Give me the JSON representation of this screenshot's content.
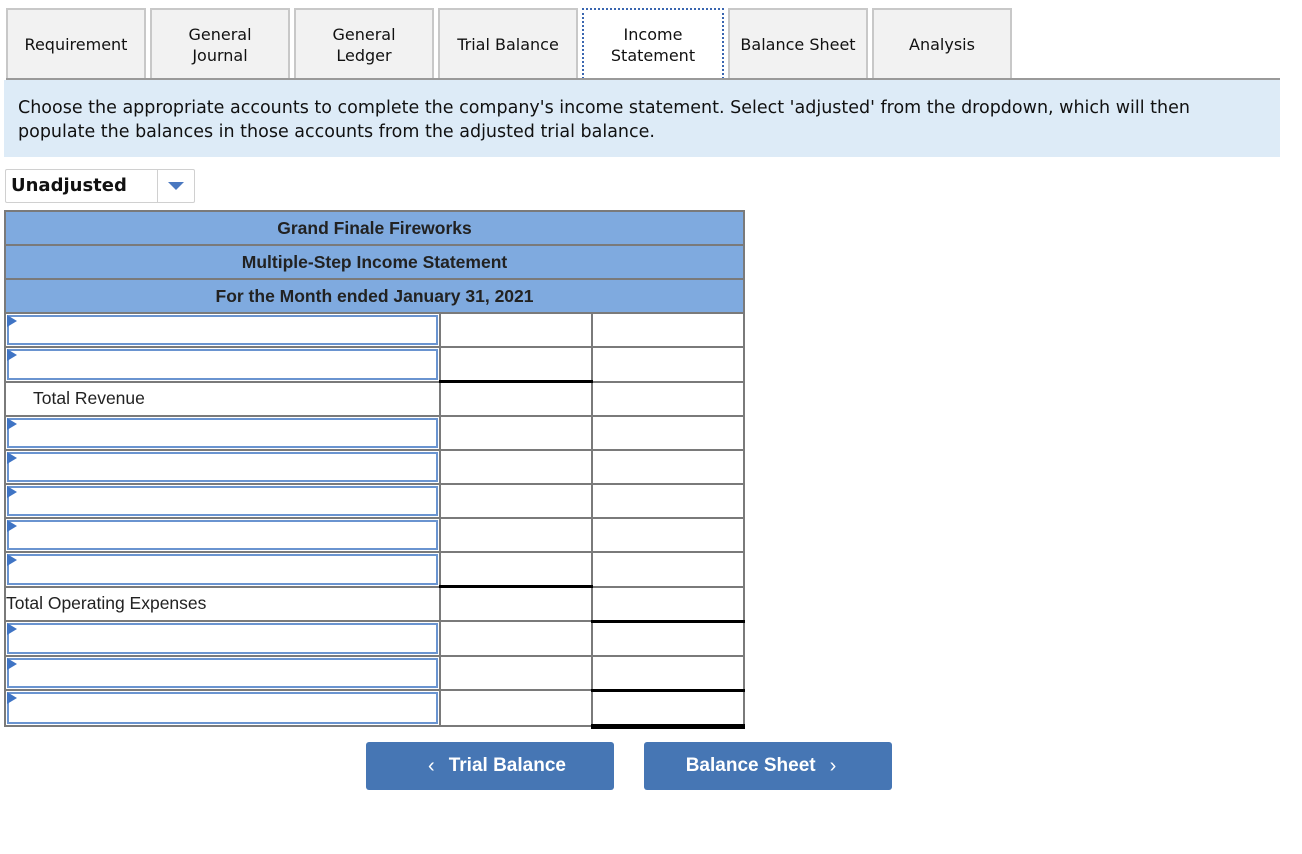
{
  "tabs": [
    {
      "label": "Requirement",
      "width": 140
    },
    {
      "label": "General\nJournal",
      "width": 140
    },
    {
      "label": "General\nLedger",
      "width": 140
    },
    {
      "label": "Trial Balance",
      "width": 140
    },
    {
      "label": "Income\nStatement",
      "width": 140,
      "active": true
    },
    {
      "label": "Balance Sheet",
      "width": 140
    },
    {
      "label": "Analysis",
      "width": 140
    }
  ],
  "instruction": "Choose the appropriate accounts to complete the company's income statement. Select 'adjusted' from the dropdown, which will then populate the balances in those accounts from the adjusted trial balance.",
  "dropdown": {
    "value": "Unadjusted",
    "icon": "chevron-down-icon"
  },
  "statement": {
    "company": "Grand Finale Fireworks",
    "title": "Multiple-Step Income Statement",
    "period": "For the Month ended January 31, 2021",
    "rows": [
      {
        "type": "select",
        "account": "",
        "amount1": "",
        "amount2": ""
      },
      {
        "type": "select",
        "account": "",
        "amount1": "",
        "amount2": ""
      },
      {
        "type": "label",
        "label": "Total Revenue",
        "amount1": "",
        "amount2": ""
      },
      {
        "type": "select",
        "account": "",
        "amount1": "",
        "amount2": ""
      },
      {
        "type": "select",
        "account": "",
        "amount1": "",
        "amount2": ""
      },
      {
        "type": "select",
        "account": "",
        "amount1": "",
        "amount2": ""
      },
      {
        "type": "select",
        "account": "",
        "amount1": "",
        "amount2": ""
      },
      {
        "type": "select",
        "account": "",
        "amount1": "",
        "amount2": ""
      },
      {
        "type": "label",
        "label": "Total Operating Expenses",
        "amount1": "",
        "amount2": ""
      },
      {
        "type": "select",
        "account": "",
        "amount1": "",
        "amount2": ""
      },
      {
        "type": "select",
        "account": "",
        "amount1": "",
        "amount2": ""
      },
      {
        "type": "select",
        "account": "",
        "amount1": "",
        "amount2": ""
      }
    ]
  },
  "nav": {
    "prev_label": "Trial Balance",
    "next_label": "Balance Sheet",
    "prev_icon": "chevron-left-icon",
    "next_icon": "chevron-right-icon"
  }
}
